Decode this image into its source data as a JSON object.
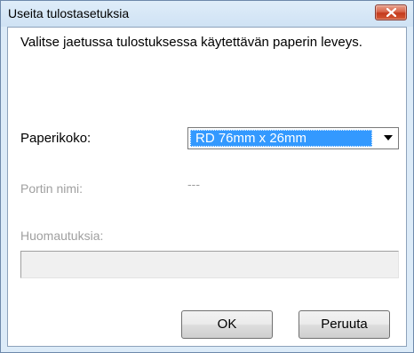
{
  "window": {
    "title": "Useita tulostasetuksia",
    "close_icon": "close-icon"
  },
  "dialog": {
    "instruction": "Valitse jaetussa tulostuksessa käytettävän paperin leveys.",
    "paper_size": {
      "label": "Paperikoko:",
      "selected": "RD 76mm x 26mm",
      "dropdown_icon": "chevron-down-icon"
    },
    "port_name": {
      "label": "Portin nimi:",
      "value": "---"
    },
    "notes": {
      "label": "Huomautuksia:",
      "value": ""
    },
    "buttons": {
      "ok": "OK",
      "cancel": "Peruuta"
    }
  },
  "colors": {
    "selection": "#3399ff",
    "close_button": "#c43a1d",
    "disabled_text": "#a0a0a0"
  }
}
